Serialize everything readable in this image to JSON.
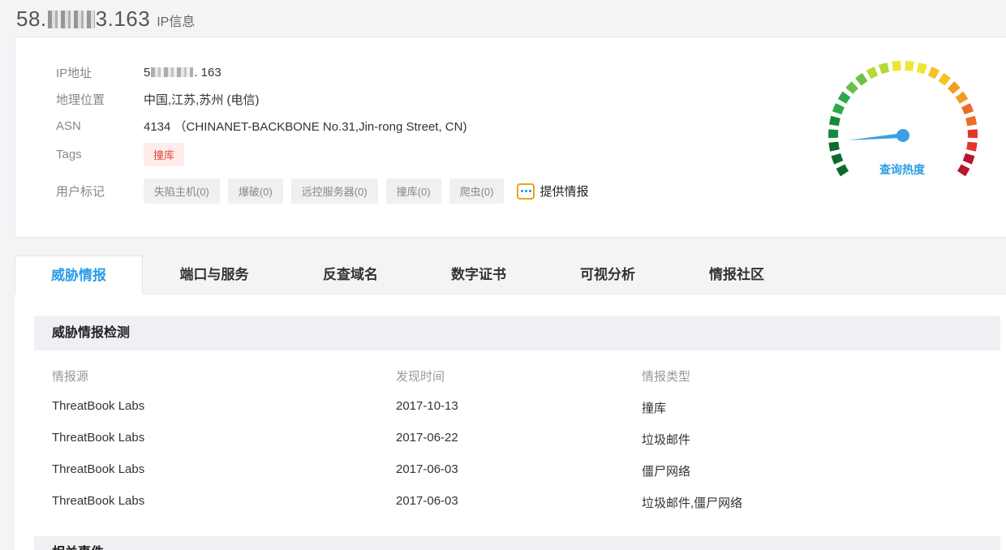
{
  "header": {
    "ip_prefix": "58.",
    "ip_suffix": "3.163",
    "subtitle": "IP信息"
  },
  "info": {
    "rows": [
      {
        "label": "IP地址",
        "value_prefix": "5",
        "value_suffix": ". 163"
      },
      {
        "label": "地理位置",
        "value": "中国,江苏,苏州 (电信)"
      },
      {
        "label": "ASN",
        "value": "4134 （CHINANET-BACKBONE No.31,Jin-rong Street, CN)"
      },
      {
        "label": "Tags",
        "tag": "撞库"
      },
      {
        "label": "用户标记"
      }
    ],
    "user_marks": [
      "失陷主机(0)",
      "爆破(0)",
      "远控服务器(0)",
      "撞库(0)",
      "爬虫(0)"
    ],
    "provide_label": "提供情报"
  },
  "gauge": {
    "label": "查询热度",
    "level": 0.12,
    "colors": [
      "#0b6b2e",
      "#128a3a",
      "#2ea84a",
      "#6cc04a",
      "#b6d936",
      "#f0e532",
      "#f6c324",
      "#f59a23",
      "#ee6b22",
      "#e2352b",
      "#b8162a"
    ]
  },
  "tabs": [
    "威胁情报",
    "端口与服务",
    "反查域名",
    "数字证书",
    "可视分析",
    "情报社区"
  ],
  "threat_section": {
    "title": "威胁情报检测",
    "headers": [
      "情报源",
      "发现时间",
      "情报类型"
    ],
    "rows": [
      [
        "ThreatBook Labs",
        "2017-10-13",
        "撞库"
      ],
      [
        "ThreatBook Labs",
        "2017-06-22",
        "垃圾邮件"
      ],
      [
        "ThreatBook Labs",
        "2017-06-03",
        "僵尸网络"
      ],
      [
        "ThreatBook Labs",
        "2017-06-03",
        "垃圾邮件,僵尸网络"
      ]
    ]
  },
  "related_section": {
    "title": "相关事件"
  }
}
